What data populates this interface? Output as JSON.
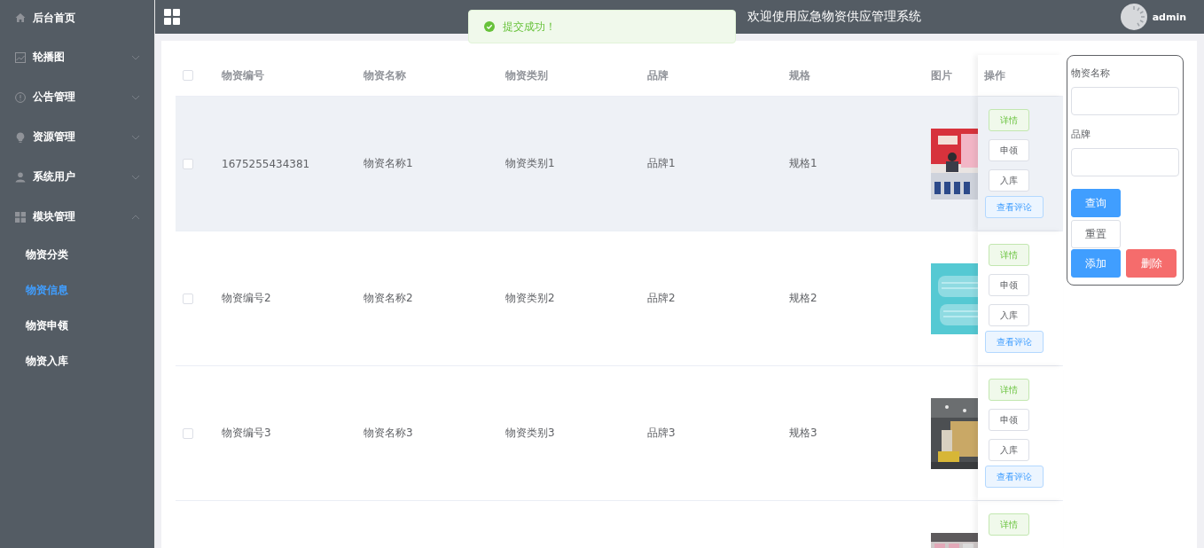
{
  "sidebar": {
    "items": [
      {
        "label": "后台首页",
        "kind": "link"
      },
      {
        "label": "轮播图",
        "kind": "submenu",
        "expanded": false
      },
      {
        "label": "公告管理",
        "kind": "submenu",
        "expanded": false
      },
      {
        "label": "资源管理",
        "kind": "submenu",
        "expanded": false
      },
      {
        "label": "系统用户",
        "kind": "submenu",
        "expanded": false
      },
      {
        "label": "模块管理",
        "kind": "submenu",
        "expanded": true,
        "children": [
          {
            "label": "物资分类",
            "selected": false
          },
          {
            "label": "物资信息",
            "selected": true
          },
          {
            "label": "物资申领",
            "selected": false
          },
          {
            "label": "物资入库",
            "selected": false
          }
        ]
      }
    ]
  },
  "header": {
    "title": "欢迎使用应急物资供应管理系统",
    "user": "admin"
  },
  "toast": {
    "kind": "success",
    "message": "提交成功！"
  },
  "table": {
    "select_all": {
      "checked": false
    },
    "columns": [
      "物资编号",
      "物资名称",
      "物资类别",
      "品牌",
      "规格",
      "图片",
      "操作"
    ],
    "rows": [
      {
        "checked": false,
        "highlighted": true,
        "cells": [
          "1675255434381",
          "物资名称1",
          "物资类别1",
          "品牌1",
          "规格1"
        ],
        "picture": {
          "kind": "picture"
        },
        "actions": [
          {
            "label": "详情",
            "kind": "success"
          },
          {
            "label": "申领",
            "kind": "default"
          },
          {
            "label": "入库",
            "kind": "default"
          },
          {
            "label": "查看评论",
            "kind": "info"
          }
        ]
      },
      {
        "checked": false,
        "highlighted": false,
        "cells": [
          "物资编号2",
          "物资名称2",
          "物资类别2",
          "品牌2",
          "规格2"
        ],
        "picture": {
          "kind": "picture"
        },
        "actions": [
          {
            "label": "详情",
            "kind": "success"
          },
          {
            "label": "申领",
            "kind": "default"
          },
          {
            "label": "入库",
            "kind": "default"
          },
          {
            "label": "查看评论",
            "kind": "info"
          }
        ]
      },
      {
        "checked": false,
        "highlighted": false,
        "cells": [
          "物资编号3",
          "物资名称3",
          "物资类别3",
          "品牌3",
          "规格3"
        ],
        "picture": {
          "kind": "picture"
        },
        "actions": [
          {
            "label": "详情",
            "kind": "success"
          },
          {
            "label": "申领",
            "kind": "default"
          },
          {
            "label": "入库",
            "kind": "default"
          },
          {
            "label": "查看评论",
            "kind": "info"
          }
        ]
      },
      {
        "highlighted": false,
        "cells": [],
        "picture": {
          "kind": "picture"
        },
        "actions": [
          {
            "label": "详情",
            "kind": "success"
          }
        ]
      }
    ]
  },
  "search": {
    "fields": [
      {
        "label": "物资名称"
      },
      {
        "label": "品牌"
      }
    ],
    "buttons": [
      {
        "label": "查询",
        "kind": "primary"
      },
      {
        "label": "重置",
        "kind": "default"
      },
      {
        "label": "添加",
        "kind": "primary"
      },
      {
        "label": "删除",
        "kind": "danger"
      }
    ]
  }
}
